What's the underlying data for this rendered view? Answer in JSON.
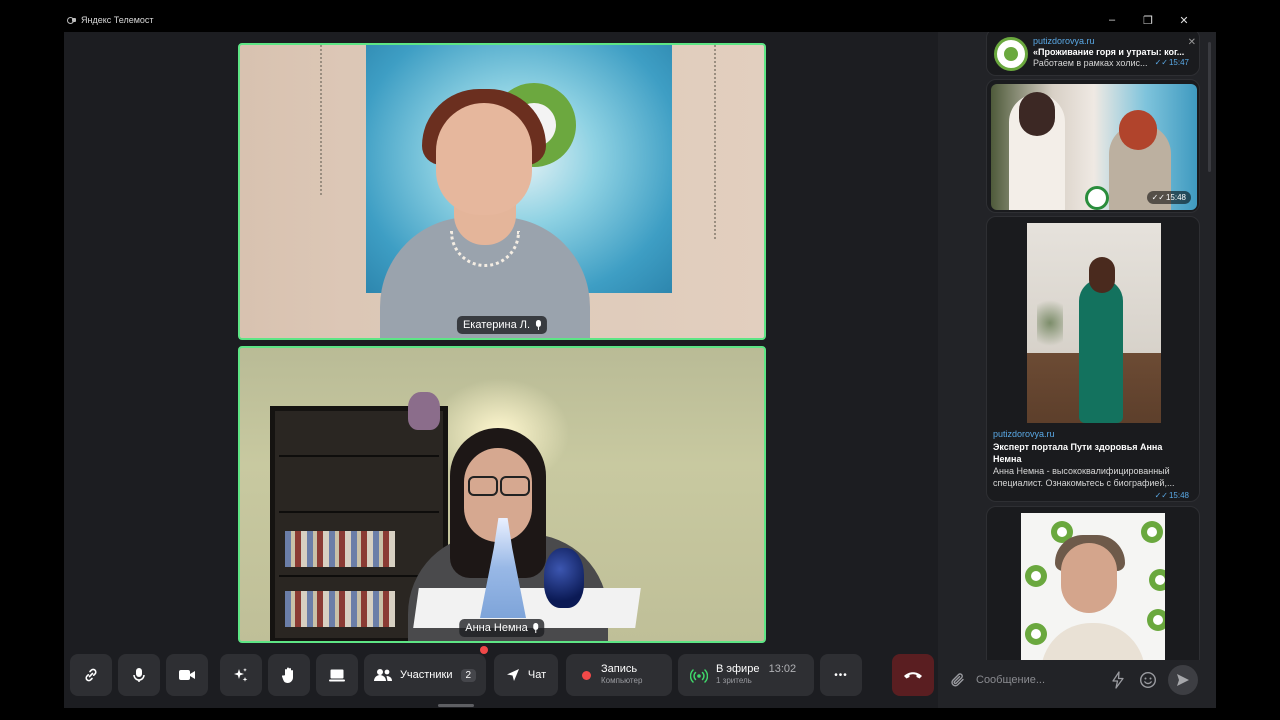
{
  "window": {
    "title": "Яндекс Телемост",
    "minimize": "–",
    "maximize": "❐",
    "close": "✕"
  },
  "participants": [
    {
      "name": "Екатерина Л.",
      "mic_icon": "microphone-icon"
    },
    {
      "name": "Анна Немна",
      "mic_icon": "microphone-icon"
    }
  ],
  "toolbar": {
    "participants_label": "Участники",
    "participants_count": "2",
    "chat_label": "Чат",
    "record_label": "Запись",
    "record_sub": "Компьютер",
    "live_label": "В эфире",
    "live_time": "13:02",
    "live_sub": "1 зритель",
    "more": "•••"
  },
  "chat": {
    "messages": [
      {
        "site": "putizdorovya.ru",
        "headline": "«Проживание горя и утраты: ког...",
        "snippet": "Работаем в рамках холис...",
        "time": "15:47"
      },
      {
        "time": "15:48"
      },
      {
        "site": "putizdorovya.ru",
        "headline": "Эксперт портала Пути здоровья Анна Немна",
        "snippet": "Анна Немна - высококвалифицированный специалист. Ознакомьтесь с биографией,...",
        "time": "15:48"
      }
    ],
    "input_placeholder": "Сообщение..."
  },
  "colors": {
    "active_speaker_border": "#5ee585",
    "record_dot": "#f24949",
    "link": "#5aa9e6",
    "hangup": "#5a1e21"
  }
}
